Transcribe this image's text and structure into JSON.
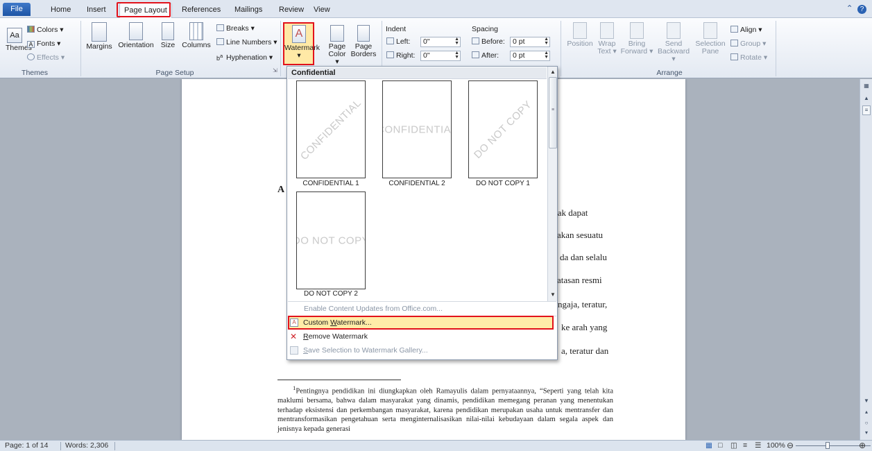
{
  "tabs": {
    "file": "File",
    "home": "Home",
    "insert": "Insert",
    "page_layout": "Page Layout",
    "references": "References",
    "mailings": "Mailings",
    "review": "Review",
    "view": "View"
  },
  "ribbon": {
    "themes_group": {
      "label": "Themes",
      "themes": "Themes",
      "colors": "Colors",
      "fonts": "Fonts",
      "effects": "Effects"
    },
    "page_setup": {
      "label": "Page Setup",
      "margins": "Margins",
      "orientation": "Orientation",
      "size": "Size",
      "columns": "Columns",
      "breaks": "Breaks",
      "line_numbers": "Line Numbers",
      "hyphenation": "Hyphenation"
    },
    "page_background": {
      "watermark": "Watermark",
      "page_color_1": "Page",
      "page_color_2": "Color",
      "page_borders_1": "Page",
      "page_borders_2": "Borders"
    },
    "paragraph": {
      "indent_label": "Indent",
      "left_label": "Left:",
      "left_value": "0\"",
      "right_label": "Right:",
      "right_value": "0\"",
      "spacing_label": "Spacing",
      "before_label": "Before:",
      "before_value": "0 pt",
      "after_label": "After:",
      "after_value": "0 pt"
    },
    "arrange": {
      "label": "Arrange",
      "position": "Position",
      "wrap_1": "Wrap",
      "wrap_2": "Text",
      "bring_1": "Bring",
      "bring_2": "Forward",
      "send_1": "Send",
      "send_2": "Backward",
      "selection_1": "Selection",
      "selection_2": "Pane",
      "align": "Align",
      "group": "Group",
      "rotate": "Rotate"
    }
  },
  "gallery": {
    "header": "Confidential",
    "items": [
      {
        "label": "CONFIDENTIAL 1",
        "text": "CONFIDENTIAL"
      },
      {
        "label": "CONFIDENTIAL 2",
        "text": "CONFIDENTIAL"
      },
      {
        "label": "DO NOT COPY 1",
        "text": "DO NOT COPY"
      },
      {
        "label": "DO NOT COPY 2",
        "text": "DO NOT COPY"
      }
    ],
    "menu": {
      "enable_updates": "Enable Content Updates from Office.com...",
      "custom_watermark_prefix": "Custom ",
      "custom_watermark_ul": "W",
      "custom_watermark_suffix": "atermark...",
      "remove_ul": "R",
      "remove_suffix": "emove Watermark",
      "save_ul": "S",
      "save_suffix": "ave Selection to Watermark Gallery..."
    }
  },
  "document": {
    "heading_letter": "A",
    "lines": [
      "tidak dapat",
      "akan sesuatu",
      "da dan selalu",
      "atasan resmi",
      "ngaja, teratur,",
      "ke arah yang",
      "a, teratur dan"
    ],
    "footnote_marker": "1",
    "footnote": "Pentingnya pendidikan ini diungkapkan oleh Ramayulis dalam pernyataannya, “Seperti yang telah kita maklumi bersama, bahwa dalam masyarakat yang dinamis, pendidikan memegang peranan yang menentukan terhadap eksistensi dan perkembangan masyarakat, karena pendidikan merupakan usaha untuk mentransfer dan mentransformasikan pengetahuan serta menginternalisasikan nilai-nilai kebudayaan dalam segala aspek dan jenisnya kepada generasi"
  },
  "status": {
    "page": "Page: 1 of 14",
    "words": "Words: 2,306",
    "zoom": "100%",
    "zoom_level_percent": 100
  },
  "colors": {
    "highlight_red": "#e2121b",
    "selected_fill": "#ffeca8",
    "file_tab": "#2a62b3"
  }
}
